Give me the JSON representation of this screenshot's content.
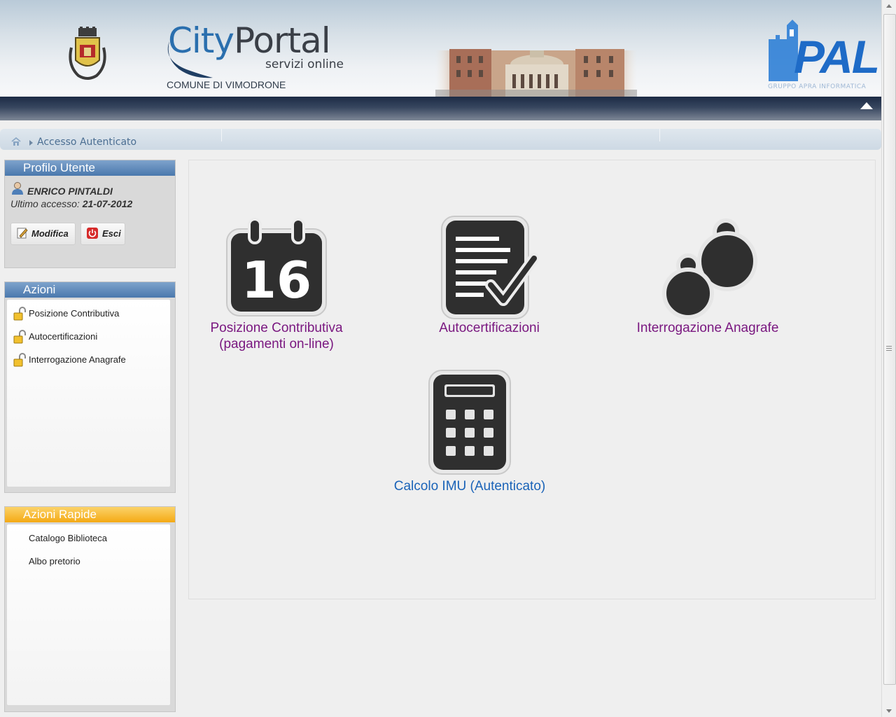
{
  "header": {
    "logo_city": "City",
    "logo_portal": "Portal",
    "logo_sub": "servizi online",
    "comune": "COMUNE DI VIMODRONE",
    "pal": "PAL",
    "pal_sub": "GRUPPO APRA INFORMATICA"
  },
  "breadcrumb": {
    "current": "Accesso Autenticato"
  },
  "profile": {
    "title": "Profilo Utente",
    "user_name": "ENRICO PINTALDI",
    "last_access_label": "Ultimo accesso:",
    "last_access_value": "21-07-2012",
    "edit_label": "Modifica",
    "exit_label": "Esci"
  },
  "actions": {
    "title": "Azioni",
    "items": [
      {
        "label": "Posizione Contributiva"
      },
      {
        "label": "Autocertificazioni"
      },
      {
        "label": "Interrogazione Anagrafe"
      }
    ]
  },
  "quick_actions": {
    "title": "Azioni Rapide",
    "items": [
      {
        "label": "Catalogo Biblioteca"
      },
      {
        "label": "Albo pretorio"
      }
    ]
  },
  "main": {
    "tiles": [
      {
        "line1": "Posizione Contributiva",
        "line2": "(pagamenti on-line)",
        "icon_text": "16"
      },
      {
        "line1": "Autocertificazioni"
      },
      {
        "line1": "Interrogazione Anagrafe"
      },
      {
        "line1": "Calcolo IMU (Autenticato)"
      }
    ]
  },
  "colors": {
    "visited_link": "#7a1880",
    "link": "#1a63b8",
    "panel_blue": "#4a78ad",
    "panel_orange": "#f4a914"
  }
}
